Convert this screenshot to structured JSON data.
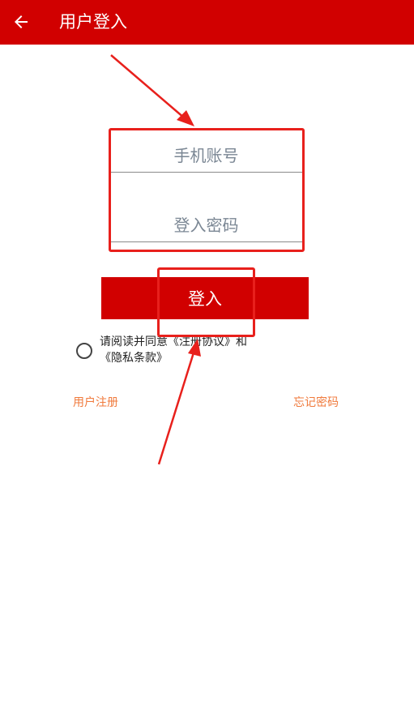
{
  "header": {
    "title": "用户登入",
    "back_icon": "arrow-left-icon",
    "background": "#d10000"
  },
  "form": {
    "phone_placeholder": "手机账号",
    "password_placeholder": "登入密码",
    "login_label": "登入"
  },
  "agreement": {
    "prefix": "请阅读并同意",
    "terms_link": "《注册协议》",
    "connector": "和",
    "privacy_link": "《隐私条款》",
    "checked": false
  },
  "links": {
    "register": "用户注册",
    "forgot": "忘记密码",
    "color": "#f07a3c"
  },
  "annotation_color": "#e8201c"
}
